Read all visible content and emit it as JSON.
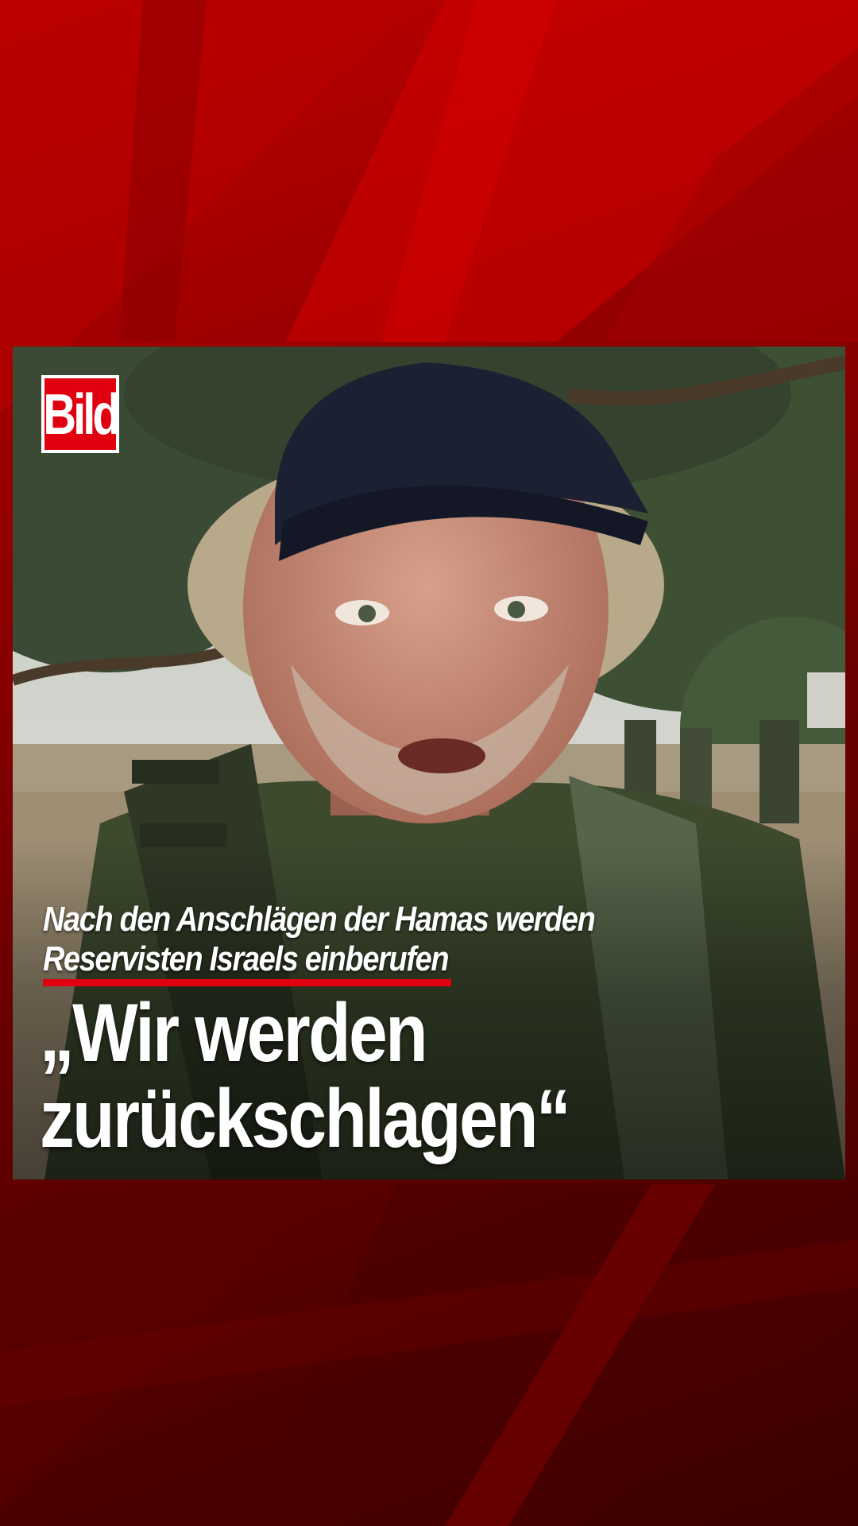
{
  "brand": {
    "logo_text": "Bild",
    "accent_color": "#e1000f"
  },
  "video": {
    "subline": [
      "Nach den Anschlägen der Hamas werden",
      "Reservisten Israels einberufen"
    ],
    "headline": [
      "„Wir werden",
      "zurückschlagen“"
    ]
  }
}
